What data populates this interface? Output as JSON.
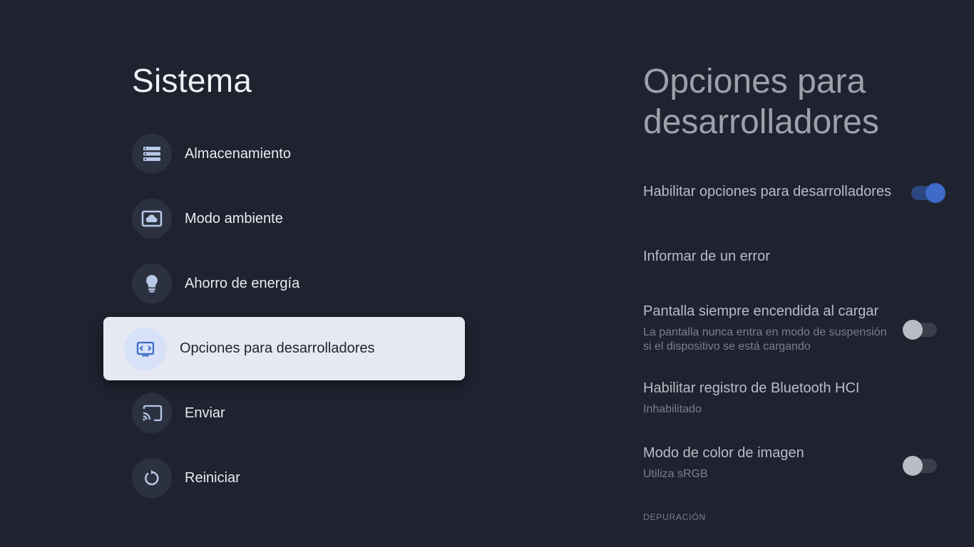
{
  "left": {
    "title": "Sistema",
    "items": [
      {
        "label": "Almacenamiento",
        "icon": "storage-icon"
      },
      {
        "label": "Modo ambiente",
        "icon": "ambient-mode-icon"
      },
      {
        "label": "Ahorro de energía",
        "icon": "lightbulb-icon"
      },
      {
        "label": "Opciones para desarrolladores",
        "icon": "developer-options-icon",
        "selected": true
      },
      {
        "label": "Enviar",
        "icon": "cast-icon"
      },
      {
        "label": "Reiniciar",
        "icon": "restart-icon"
      }
    ]
  },
  "right": {
    "title": "Opciones para desarrolladores",
    "settings": [
      {
        "title": "Habilitar opciones para desarrolladores",
        "toggle": "on"
      },
      {
        "title": "Informar de un error"
      },
      {
        "title": "Pantalla siempre encendida al cargar",
        "subtitle": "La pantalla nunca entra en modo de suspensión si el dispositivo se está cargando",
        "toggle": "off"
      },
      {
        "title": "Habilitar registro de Bluetooth HCI",
        "subtitle": "Inhabilitado"
      },
      {
        "title": "Modo de color de imagen",
        "subtitle": "Utiliza sRGB",
        "toggle": "off"
      }
    ],
    "section_label": "DEPURACIÓN"
  },
  "colors": {
    "background": "#1f2330",
    "accent": "#3d6bc7",
    "selected_background": "#e6e8f2"
  }
}
